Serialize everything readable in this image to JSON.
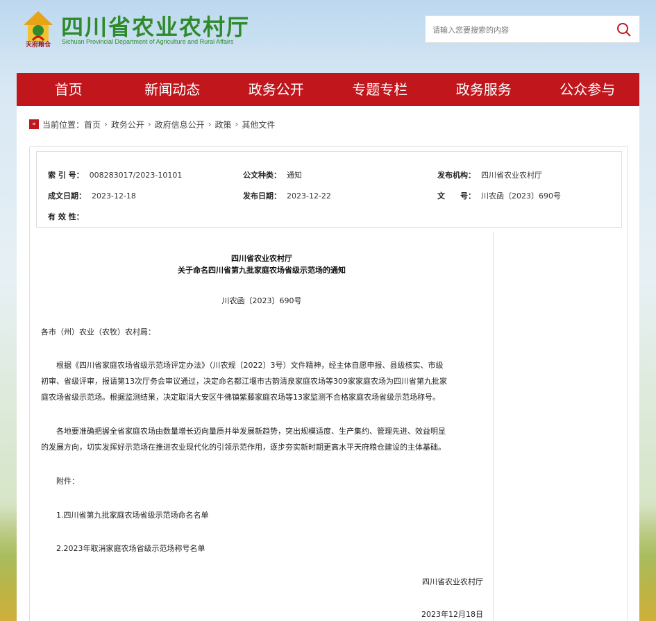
{
  "header": {
    "logo_tag": "天府粮仓",
    "title": "四川省农业农村厅",
    "subtitle": "Sichuan Provincial Department of Agriculture and Rural Affairs",
    "search_placeholder": "请输入您要搜索的内容"
  },
  "nav": {
    "items": [
      "首页",
      "新闻动态",
      "政务公开",
      "专题专栏",
      "政务服务",
      "公众参与"
    ]
  },
  "breadcrumb": {
    "prefix": "当前位置：",
    "items": [
      "首页",
      "政务公开",
      "政府信息公开",
      "政策",
      "其他文件"
    ],
    "sep": "›"
  },
  "meta": {
    "index_label": "索 引 号：",
    "index_value": "008283017/2023-10101",
    "type_label": "公文种类：",
    "type_value": "通知",
    "org_label": "发布机构：",
    "org_value": "四川省农业农村厅",
    "created_label": "成文日期：",
    "created_value": "2023-12-18",
    "published_label": "发布日期：",
    "published_value": "2023-12-22",
    "docno_label": "文　　号：",
    "docno_value": "川农函〔2023〕690号",
    "validity_label": "有 效 性："
  },
  "article": {
    "title_line1": "四川省农业农村厅",
    "title_line2": "关于命名四川省第九批家庭农场省级示范场的通知",
    "doc_number": "川农函〔2023〕690号",
    "salutation": "各市（州）农业（农牧）农村局：",
    "para1_line1": "　　根据《四川省家庭农场省级示范场评定办法》（川农规〔2022〕3号）文件精神，经主体自愿申报、县级核实、市级",
    "para1_line2": "初审、省级评审，报请第13次厅务会审议通过，决定命名都江堰市古韵清泉家庭农场等309家家庭农场为四川省第九批家",
    "para1_line3": "庭农场省级示范场。根据监测结果，决定取消大安区牛佛镇紫藤家庭农场等13家监测不合格家庭农场省级示范场称号。",
    "para2_line1": "　　各地要准确把握全省家庭农场由数量增长迈向量质并举发展新趋势，突出规模适度、生产集约、管理先进、效益明显",
    "para2_line2": "的发展方向，切实发挥好示范场在推进农业现代化的引领示范作用，逐步夯实新时期更高水平天府粮仓建设的主体基础。",
    "attach_label": "　　附件：",
    "attach1": "　　1.四川省第九批家庭农场省级示范场命名名单",
    "attach2": "　　2.2023年取消家庭农场省级示范场称号名单",
    "signature": "四川省农业农村厅",
    "date": "2023年12月18日"
  },
  "colors": {
    "brand_red": "#c0161c",
    "brand_green": "#2f8a2c"
  }
}
